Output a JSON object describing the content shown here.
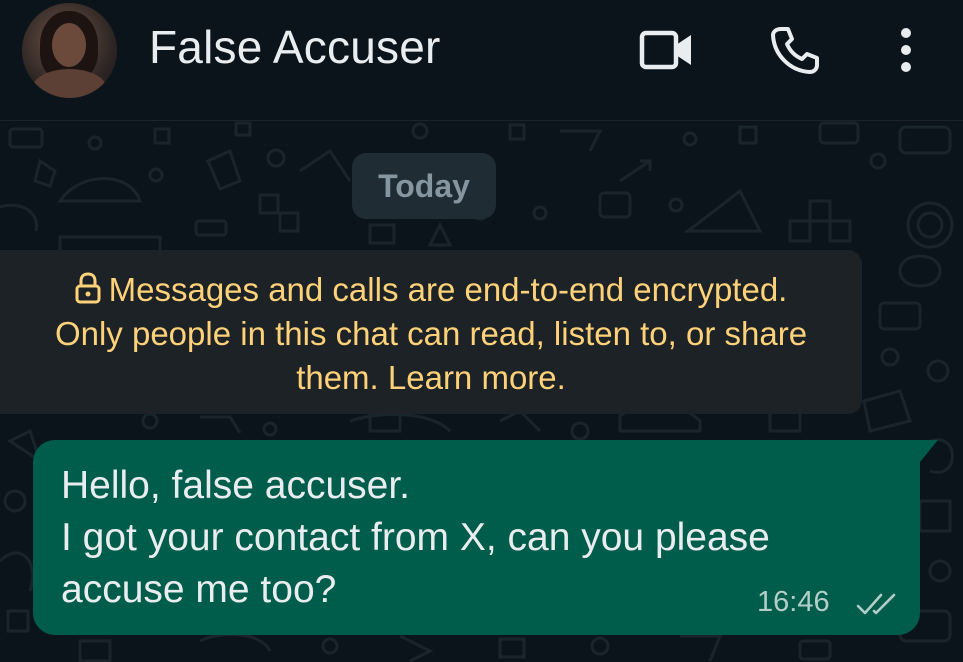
{
  "header": {
    "contact_name": "False Accuser",
    "avatar_icon": "profile-photo",
    "actions": [
      {
        "icon": "video-camera-icon"
      },
      {
        "icon": "phone-icon"
      },
      {
        "icon": "more-vertical-icon"
      }
    ]
  },
  "chat": {
    "date_separator": "Today",
    "encryption_notice": {
      "icon": "lock-icon",
      "line1": "Messages and calls are end-to-end encrypted.",
      "line2": "Only people in this chat can read, listen to, or share",
      "line3": "them. Learn more."
    },
    "messages": [
      {
        "direction": "outgoing",
        "lines": [
          "Hello, false accuser.",
          "I got your contact from X, can you please",
          "accuse me too?"
        ],
        "time": "16:46",
        "status_icon": "double-check-icon"
      }
    ]
  },
  "colors": {
    "background": "#0b141a",
    "outgoing_bubble": "#005c4b",
    "system_text": "#ffd279",
    "primary_text": "#e9edef",
    "secondary_text": "#8696a0"
  }
}
